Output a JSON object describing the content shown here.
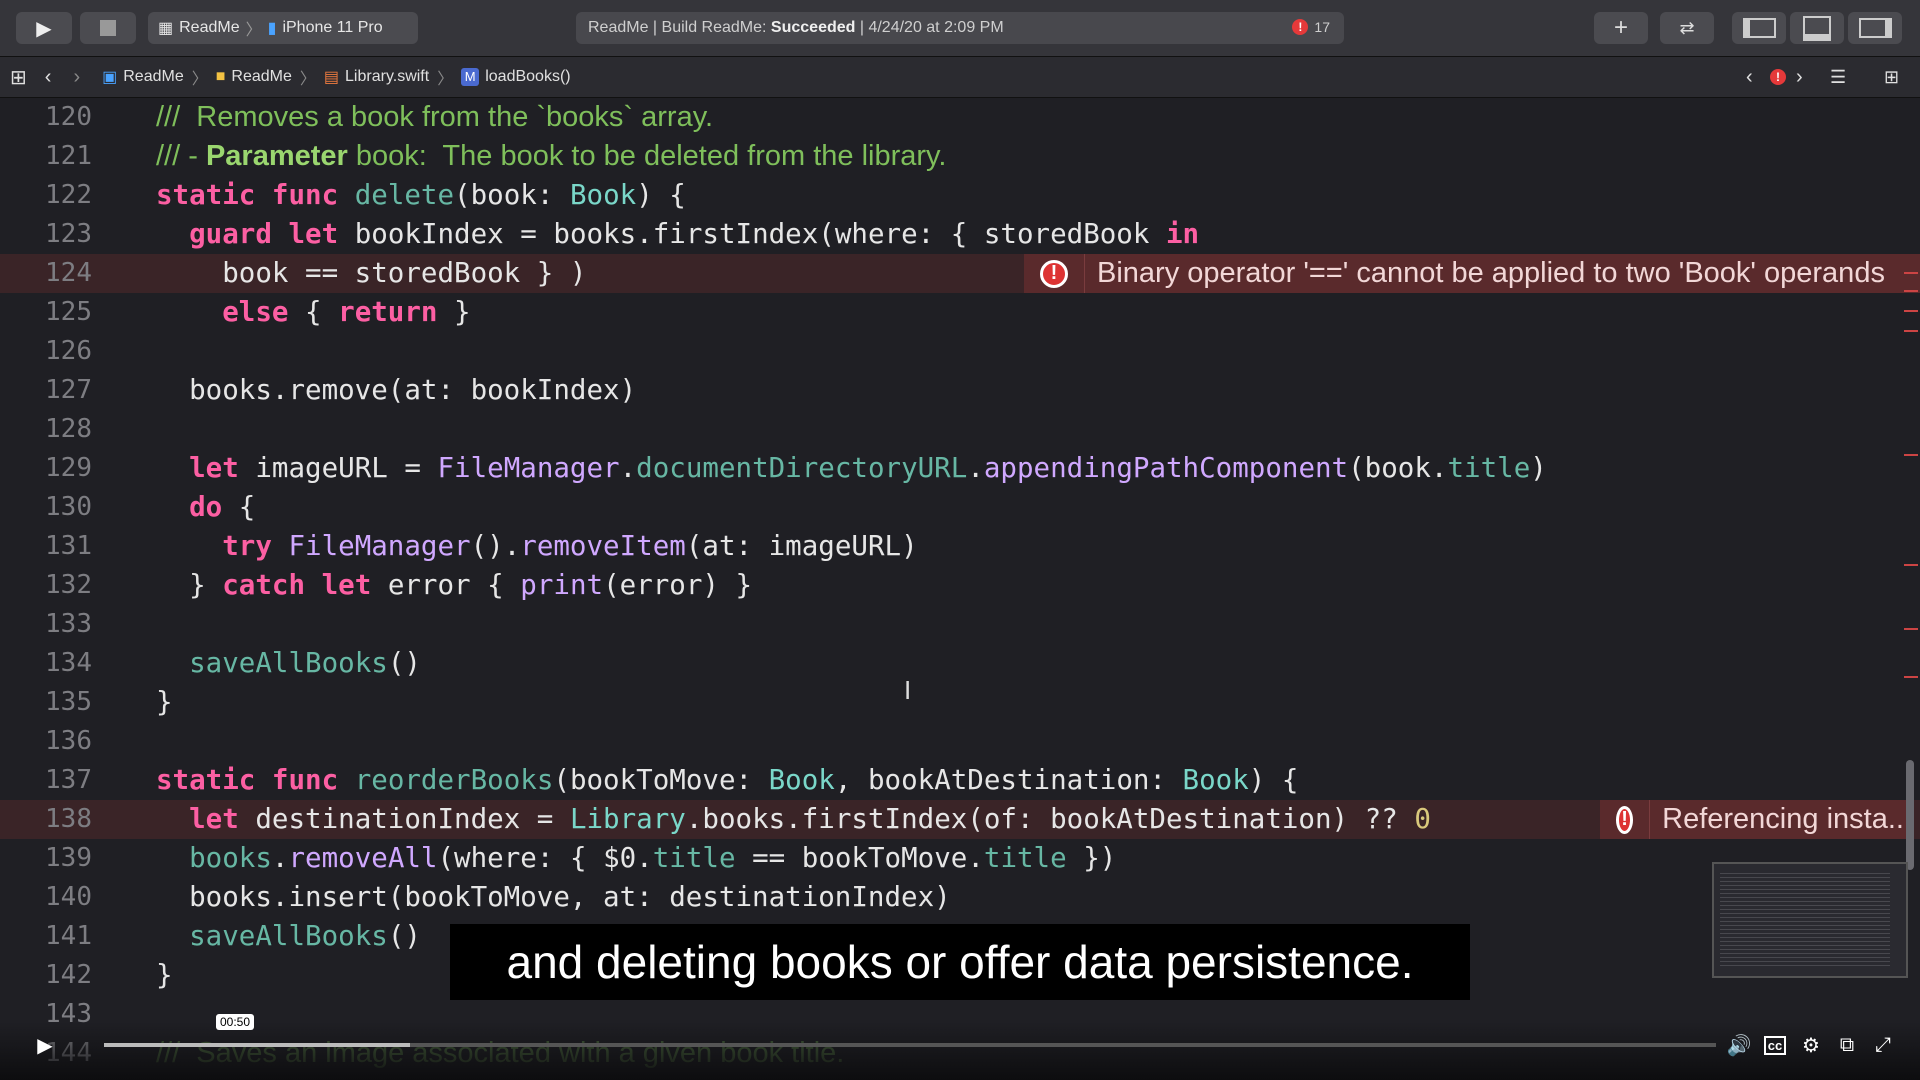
{
  "toolbar": {
    "scheme_project": "ReadMe",
    "scheme_device": "iPhone 11 Pro",
    "status_prefix": "ReadMe | Build ReadMe: ",
    "status_result": "Succeeded",
    "status_time": " | 4/24/20 at 2:09 PM",
    "error_count": "17",
    "error_glyph": "!"
  },
  "jumpbar": {
    "crumbs": [
      "ReadMe",
      "ReadMe",
      "Library.swift",
      "loadBooks()"
    ],
    "method_badge": "M",
    "error_glyph": "!"
  },
  "editor": {
    "line_numbers": [
      "120",
      "121",
      "122",
      "123",
      "124",
      "125",
      "126",
      "127",
      "128",
      "129",
      "130",
      "131",
      "132",
      "133",
      "134",
      "135",
      "136",
      "137",
      "138",
      "139",
      "140",
      "141",
      "142",
      "143",
      "144"
    ],
    "error1_glyph": "!",
    "error1": "Binary operator '==' cannot be applied to two 'Book' operands",
    "error2_glyph": "!",
    "error2": "Referencing insta..."
  },
  "caption": "and deleting books or offer data persistence.",
  "player": {
    "time_tooltip": "00:50",
    "progress": 0.19
  },
  "colors": {
    "keyword": "#fc5fa3",
    "comment": "#7fbf5b",
    "error": "#e5393a"
  }
}
